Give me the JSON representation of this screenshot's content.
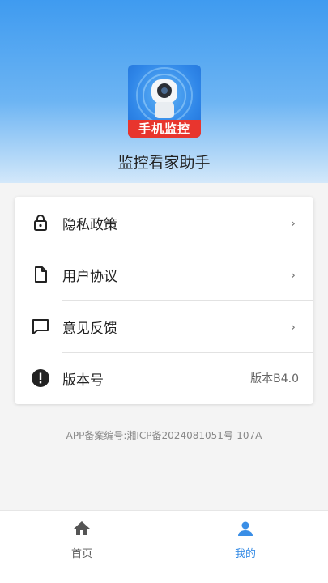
{
  "app": {
    "name": "监控看家助手",
    "icon_banner": "手机监控"
  },
  "menu": {
    "items": [
      {
        "label": "隐私政策",
        "icon": "lock-icon",
        "chevron": "›"
      },
      {
        "label": "用户协议",
        "icon": "document-icon",
        "chevron": "›"
      },
      {
        "label": "意见反馈",
        "icon": "feedback-icon",
        "chevron": "›"
      },
      {
        "label": "版本号",
        "icon": "info-icon",
        "value": "版本B4.0"
      }
    ]
  },
  "footer": {
    "icp": "APP备案编号:湘ICP备2024081051号-107A"
  },
  "tabbar": {
    "tabs": [
      {
        "label": "首页",
        "icon": "home-icon",
        "active": false
      },
      {
        "label": "我的",
        "icon": "user-icon",
        "active": true
      }
    ]
  },
  "colors": {
    "accent": "#3a8ee6",
    "header_top": "#3f9bf0",
    "banner_red": "#e8352e",
    "inactive_tab": "#555555"
  }
}
